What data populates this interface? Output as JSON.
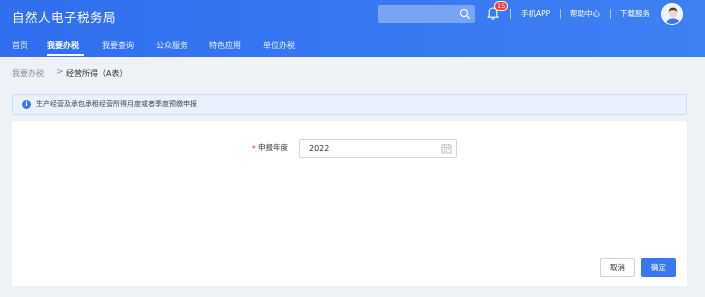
{
  "app": {
    "title": "自然人电子税务局"
  },
  "header": {
    "search": {
      "value": "",
      "placeholder": ""
    },
    "notification_count": "15",
    "links": [
      "手机APP",
      "帮助中心",
      "下载服务"
    ]
  },
  "nav": {
    "items": [
      "首页",
      "我要办税",
      "我要查询",
      "公众服务",
      "特色应用",
      "单位办税"
    ],
    "active": "我要办税"
  },
  "breadcrumb": {
    "parent": "我要办税",
    "separator": ">",
    "current": "经营所得（A表）"
  },
  "notice": {
    "text": "生产经营及承包承租经营所得月度或者季度预缴申报"
  },
  "form": {
    "required_mark": "*",
    "year_label": "申报年度",
    "year_value": "2022"
  },
  "buttons": {
    "cancel": "取消",
    "ok": "确定"
  },
  "colors": {
    "primary": "#3a78f2",
    "header": "#2f6ff0",
    "badge": "#f04134"
  },
  "icons": [
    "search-icon",
    "bell-icon",
    "user-avatar-icon",
    "info-icon",
    "calendar-icon"
  ]
}
